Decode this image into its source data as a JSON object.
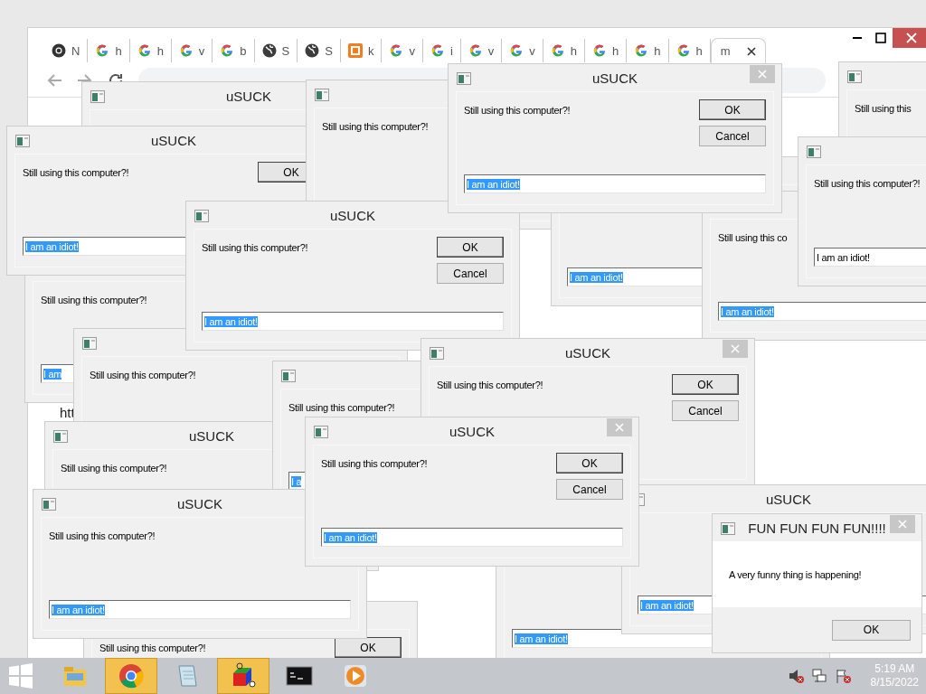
{
  "browser": {
    "tabs": [
      {
        "kind": "chrome",
        "label": "N",
        "selected": false
      },
      {
        "kind": "google",
        "label": "h",
        "selected": false
      },
      {
        "kind": "google",
        "label": "h",
        "selected": false
      },
      {
        "kind": "google",
        "label": "v",
        "selected": false
      },
      {
        "kind": "google",
        "label": "b",
        "selected": false
      },
      {
        "kind": "globe",
        "label": "S",
        "selected": false
      },
      {
        "kind": "globe",
        "label": "S",
        "selected": false
      },
      {
        "kind": "xampp",
        "label": "k",
        "selected": false
      },
      {
        "kind": "google",
        "label": "v",
        "selected": false
      },
      {
        "kind": "google",
        "label": "i",
        "selected": false
      },
      {
        "kind": "google",
        "label": "v",
        "selected": false
      },
      {
        "kind": "google",
        "label": "v",
        "selected": false
      },
      {
        "kind": "google",
        "label": "h",
        "selected": false
      },
      {
        "kind": "google",
        "label": "h",
        "selected": false
      },
      {
        "kind": "google",
        "label": "h",
        "selected": false
      },
      {
        "kind": "google",
        "label": "h",
        "selected": false
      },
      {
        "kind": "page",
        "label": "m",
        "selected": true
      }
    ],
    "page_text": "htt"
  },
  "windows": [
    {
      "kind": "dialog",
      "title": "uSUCK"
    },
    {
      "kind": "dialog",
      "message": "Still using this computer?!"
    },
    {
      "kind": "dialog",
      "title": "uSUCK",
      "message": "Still using this computer?!",
      "ok": "OK",
      "cancel": "Cancel",
      "field": {
        "value": "I am an idiot!",
        "selected": true
      }
    },
    {
      "kind": "dialog",
      "message": "Still using this"
    },
    {
      "kind": "dialog",
      "title": "uSUCK",
      "message": "Still using this computer?!",
      "ok": "OK",
      "field": {
        "value": "I am an idiot!",
        "selected": true
      }
    },
    {
      "kind": "dialog",
      "message": "Still using this computer?!",
      "field": {
        "value": "I am",
        "selected": true
      }
    },
    {
      "kind": "dialog",
      "title": "uSUCK",
      "message": "Still using this computer?!",
      "ok": "OK",
      "cancel": "Cancel",
      "field": {
        "value": "I am an idiot!",
        "selected": true
      }
    },
    {
      "kind": "dialog",
      "field": {
        "value": "I am an idiot!",
        "selected": true
      }
    },
    {
      "kind": "dialog",
      "message": "Still using this co",
      "field": {
        "value": "I am an idiot!",
        "selected": true
      }
    },
    {
      "kind": "dialog",
      "message": "Still using this computer?!",
      "field": {
        "value": "I am an idiot!",
        "selected": false
      }
    },
    {
      "kind": "dialog",
      "message": "Still using this computer?!"
    },
    {
      "kind": "dialog",
      "title": "uSUCK",
      "message": "Still using this computer?!"
    },
    {
      "kind": "dialog",
      "message": "Still using this computer?!",
      "field": {
        "value": "I a",
        "selected": true
      }
    },
    {
      "kind": "dialog",
      "title": "uSUCK",
      "message": "Still using this computer?!",
      "ok": "OK",
      "cancel": "Cancel"
    },
    {
      "kind": "dialog",
      "title": "uSUCK",
      "message": "Still using this computer?!",
      "field": {
        "value": "I am an idiot!",
        "selected": true
      }
    },
    {
      "kind": "dialog",
      "title": "uSUCK",
      "message": "Still using this computer?!",
      "ok": "OK",
      "cancel": "Cancel",
      "field": {
        "value": "I am an idiot!",
        "selected": true
      }
    },
    {
      "kind": "dialog",
      "field": {
        "value": "I am an idiot!",
        "selected": true
      }
    },
    {
      "kind": "dialog",
      "title": "uSUCK",
      "field": {
        "value": "I am an idiot!",
        "selected": true
      }
    },
    {
      "kind": "dialog",
      "message": "Still using this computer?!",
      "ok": "OK"
    },
    {
      "kind": "notice",
      "title": "FUN FUN FUN FUN!!!!",
      "message": "A very funny thing is happening!",
      "ok": "OK"
    }
  ],
  "taskbar": {
    "apps": [
      {
        "kind": "explorer",
        "active": false
      },
      {
        "kind": "chrome",
        "active": true
      },
      {
        "kind": "notepad",
        "active": false
      },
      {
        "kind": "cube",
        "active": true
      },
      {
        "kind": "console",
        "active": false
      },
      {
        "kind": "media",
        "active": false
      }
    ],
    "time": "5:19 AM",
    "date": "8/15/2022"
  }
}
